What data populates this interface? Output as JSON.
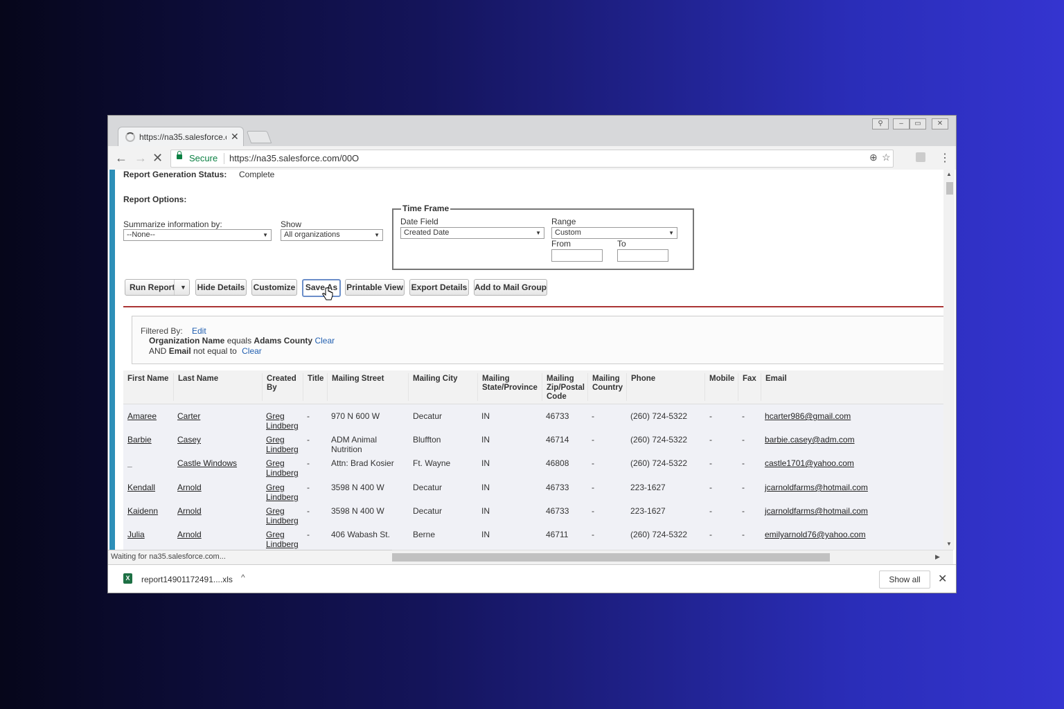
{
  "browser": {
    "tab_title": "https://na35.salesforce.c",
    "secure_label": "Secure",
    "url": "https://na35.salesforce.com/00O"
  },
  "report": {
    "status_label": "Report Generation Status:",
    "status_value": "Complete",
    "options_label": "Report Options:",
    "summarize_label": "Summarize information by:",
    "summarize_value": "--None--",
    "show_label": "Show",
    "show_value": "All organizations",
    "timeframe": {
      "legend": "Time Frame",
      "date_field_label": "Date Field",
      "date_field_value": "Created Date",
      "range_label": "Range",
      "range_value": "Custom",
      "from_label": "From",
      "to_label": "To",
      "from_value": "",
      "to_value": ""
    }
  },
  "buttons": {
    "run_report": "Run Report",
    "hide_details": "Hide Details",
    "customize": "Customize",
    "save_as": "Save As",
    "printable_view": "Printable View",
    "export_details": "Export Details",
    "add_to_mail_group": "Add to Mail Group"
  },
  "filter": {
    "label": "Filtered By:",
    "edit": "Edit",
    "line1_field": "Organization Name",
    "line1_op": "equals",
    "line1_value": "Adams County",
    "line1_clear": "Clear",
    "line2_and": "AND",
    "line2_field": "Email",
    "line2_op": "not equal to",
    "line2_clear": "Clear"
  },
  "table": {
    "headers": {
      "first_name": "First Name",
      "last_name": "Last Name",
      "created_by": "Created By",
      "title": "Title",
      "street": "Mailing Street",
      "city": "Mailing City",
      "state": "Mailing State/Province",
      "zip": "Mailing Zip/Postal Code",
      "country": "Mailing Country",
      "phone": "Phone",
      "mobile": "Mobile",
      "fax": "Fax",
      "email": "Email"
    },
    "rows": [
      {
        "first": "Amaree",
        "last": "Carter",
        "created_by": "Greg Lindberg",
        "title": "-",
        "street": "970 N 600 W",
        "city": "Decatur",
        "state": "IN",
        "zip": "46733",
        "country": "-",
        "phone": "(260) 724-5322",
        "mobile": "-",
        "fax": "-",
        "email": "hcarter986@gmail.com"
      },
      {
        "first": "Barbie",
        "last": "Casey",
        "created_by": "Greg Lindberg",
        "title": "-",
        "street": "ADM Animal Nutrition",
        "city": "Bluffton",
        "state": "IN",
        "zip": "46714",
        "country": "-",
        "phone": "(260) 724-5322",
        "mobile": "-",
        "fax": "-",
        "email": "barbie.casey@adm.com"
      },
      {
        "first": "_",
        "last": "Castle Windows",
        "created_by": "Greg Lindberg",
        "title": "-",
        "street": "Attn: Brad Kosier",
        "city": "Ft. Wayne",
        "state": "IN",
        "zip": "46808",
        "country": "-",
        "phone": "(260) 724-5322",
        "mobile": "-",
        "fax": "-",
        "email": "castle1701@yahoo.com"
      },
      {
        "first": "Kendall",
        "last": "Arnold",
        "created_by": "Greg Lindberg",
        "title": "-",
        "street": "3598 N 400 W",
        "city": "Decatur",
        "state": "IN",
        "zip": "46733",
        "country": "-",
        "phone": "223-1627",
        "mobile": "-",
        "fax": "-",
        "email": "jcarnoldfarms@hotmail.com"
      },
      {
        "first": "Kaidenn",
        "last": "Arnold",
        "created_by": "Greg Lindberg",
        "title": "-",
        "street": "3598 N 400 W",
        "city": "Decatur",
        "state": "IN",
        "zip": "46733",
        "country": "-",
        "phone": "223-1627",
        "mobile": "-",
        "fax": "-",
        "email": "jcarnoldfarms@hotmail.com"
      },
      {
        "first": "Julia",
        "last": "Arnold",
        "created_by": "Greg Lindberg",
        "title": "-",
        "street": "406 Wabash St.",
        "city": "Berne",
        "state": "IN",
        "zip": "46711",
        "country": "-",
        "phone": "(260) 724-5322",
        "mobile": "-",
        "fax": "-",
        "email": "emilyarnold76@yahoo.com"
      }
    ]
  },
  "statusbar": {
    "text": "Waiting for na35.salesforce.com..."
  },
  "downloads": {
    "file": "report14901172491....xls",
    "show_all": "Show all"
  }
}
